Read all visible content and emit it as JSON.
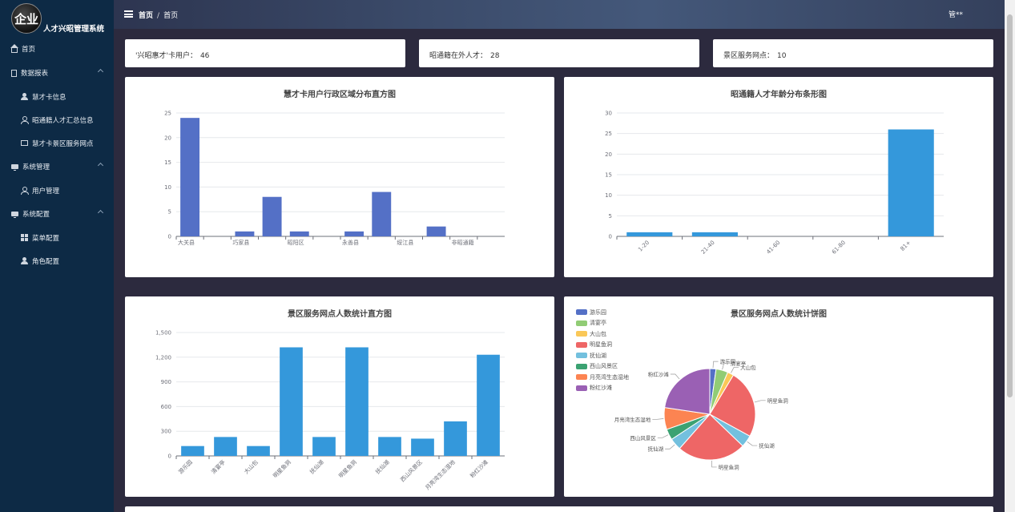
{
  "sidebar": {
    "logo_text": "企业",
    "app_title": "人才兴昭管理系统",
    "items": [
      {
        "label": "首页",
        "icon": "home-icon"
      },
      {
        "label": "数据报表",
        "icon": "document-icon"
      },
      {
        "label": "慧才卡信息",
        "icon": "user-icon"
      },
      {
        "label": "昭通籍人才汇总信息",
        "icon": "user-outline-icon"
      },
      {
        "label": "慧才卡景区服务网点",
        "icon": "card-icon"
      },
      {
        "label": "系统管理",
        "icon": "monitor-icon"
      },
      {
        "label": "用户管理",
        "icon": "user-outline-icon"
      },
      {
        "label": "系统配置",
        "icon": "monitor-icon"
      },
      {
        "label": "菜单配置",
        "icon": "grid-icon"
      },
      {
        "label": "角色配置",
        "icon": "user-icon"
      }
    ]
  },
  "header": {
    "crumb_home": "首页",
    "crumb_sep": "/",
    "crumb_current": "首页",
    "user": "管**"
  },
  "stats": [
    {
      "label": "'兴昭惠才'卡用户：",
      "value": "46"
    },
    {
      "label": "昭通籍在外人才：",
      "value": "28"
    },
    {
      "label": "景区服务网点：",
      "value": "10"
    }
  ],
  "chart_data": [
    {
      "type": "bar",
      "title": "慧才卡用户行政区域分布直方图",
      "categories": [
        "大关县",
        "巧家县",
        "昭阳区",
        "永善县",
        "绥江县",
        "非昭通籍"
      ],
      "bar_labels": [
        "大关县",
        "",
        "巧家县",
        "",
        "昭阳区",
        "",
        "永善县",
        "",
        "绥江县",
        "",
        "非昭通籍",
        ""
      ],
      "values": [
        24,
        0,
        1,
        8,
        1,
        0,
        1,
        9,
        0,
        2,
        0,
        0
      ],
      "ylim": [
        0,
        25
      ],
      "yticks": [
        "0",
        "5",
        "10",
        "15",
        "20",
        "25"
      ],
      "color": "#5470c6",
      "grid": true
    },
    {
      "type": "bar",
      "title": "昭通籍人才年龄分布条形图",
      "categories": [
        "1-20",
        "21-40",
        "41-60",
        "61-80",
        "81+"
      ],
      "values": [
        1,
        1,
        0,
        0,
        26
      ],
      "ylim": [
        0,
        30
      ],
      "yticks": [
        "0",
        "5",
        "10",
        "15",
        "20",
        "25",
        "30"
      ],
      "color": "#3498db",
      "grid": true
    },
    {
      "type": "bar",
      "title": "景区服务网点人数统计直方图",
      "categories": [
        "游乐园",
        "清宴亭",
        "大山包",
        "明星鱼洞",
        "抚仙湖",
        "明星鱼洞",
        "抚仙湖",
        "西山风景区",
        "月亮湾生态湿地",
        "粉红沙滩"
      ],
      "values": [
        120,
        230,
        120,
        1320,
        230,
        1320,
        230,
        210,
        420,
        1230
      ],
      "ylim": [
        0,
        1500
      ],
      "yticks": [
        "0",
        "300",
        "600",
        "900",
        "1,200",
        "1,500"
      ],
      "color": "#3498db",
      "grid": true
    },
    {
      "type": "pie",
      "title": "景区服务网点人数统计饼图",
      "legend": [
        "游乐园",
        "清宴亭",
        "大山包",
        "明星鱼洞",
        "抚仙湖",
        "西山风景区",
        "月亮湾生态湿地",
        "粉红沙滩"
      ],
      "legend_position": "top-left",
      "slices": [
        {
          "name": "游乐园",
          "value": 120,
          "color": "#5470c6"
        },
        {
          "name": "清宴亭",
          "value": 230,
          "color": "#91cc75"
        },
        {
          "name": "大山包",
          "value": 120,
          "color": "#fac858"
        },
        {
          "name": "明星鱼洞",
          "value": 1320,
          "color": "#ee6666"
        },
        {
          "name": "抚仙湖",
          "value": 230,
          "color": "#73c0de"
        },
        {
          "name": "明星鱼洞",
          "value": 1320,
          "color": "#ee6666"
        },
        {
          "name": "抚仙湖",
          "value": 230,
          "color": "#73c0de"
        },
        {
          "name": "西山风景区",
          "value": 210,
          "color": "#3ba272"
        },
        {
          "name": "月亮湾生态湿地",
          "value": 420,
          "color": "#fc8452"
        },
        {
          "name": "粉红沙滩",
          "value": 1230,
          "color": "#9a60b4"
        }
      ]
    }
  ]
}
